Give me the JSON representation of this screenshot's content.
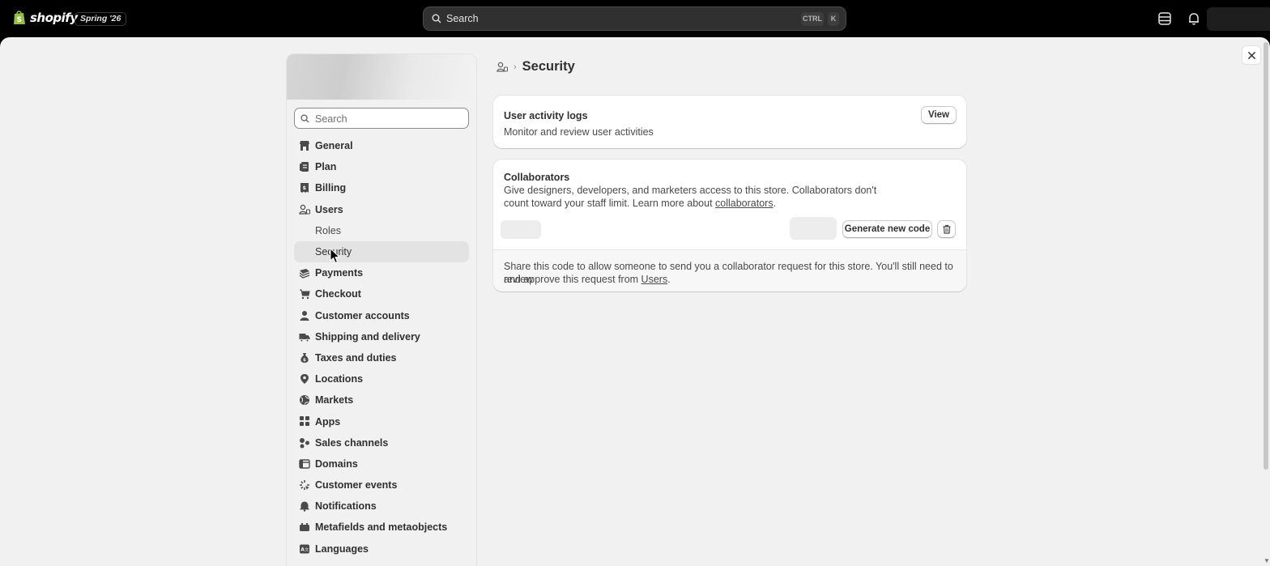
{
  "topbar": {
    "brand": "shopify",
    "edition": "Spring '26",
    "search_label": "Search",
    "shortcut_ctrl": "CTRL",
    "shortcut_key": "K",
    "icons": [
      "store-status-icon",
      "bell-icon"
    ]
  },
  "sidebar": {
    "search_placeholder": "Search",
    "items": [
      {
        "label": "General",
        "icon": "store-icon"
      },
      {
        "label": "Plan",
        "icon": "plan-icon"
      },
      {
        "label": "Billing",
        "icon": "receipt-icon"
      },
      {
        "label": "Users",
        "icon": "users-icon"
      },
      {
        "label": "Roles",
        "icon": ""
      },
      {
        "label": "Security",
        "icon": ""
      },
      {
        "label": "Payments",
        "icon": "payments-icon"
      },
      {
        "label": "Checkout",
        "icon": "cart-icon"
      },
      {
        "label": "Customer accounts",
        "icon": "person-icon"
      },
      {
        "label": "Shipping and delivery",
        "icon": "truck-icon"
      },
      {
        "label": "Taxes and duties",
        "icon": "tax-icon"
      },
      {
        "label": "Locations",
        "icon": "location-icon"
      },
      {
        "label": "Markets",
        "icon": "globe-icon"
      },
      {
        "label": "Apps",
        "icon": "apps-icon"
      },
      {
        "label": "Sales channels",
        "icon": "channels-icon"
      },
      {
        "label": "Domains",
        "icon": "domain-icon"
      },
      {
        "label": "Customer events",
        "icon": "events-icon"
      },
      {
        "label": "Notifications",
        "icon": "bell-icon"
      },
      {
        "label": "Metafields and metaobjects",
        "icon": "metafields-icon"
      },
      {
        "label": "Languages",
        "icon": "languages-icon"
      }
    ]
  },
  "main": {
    "title": "Security",
    "activity_card": {
      "title": "User activity logs",
      "description": "Monitor and review user activities",
      "view_button": "View"
    },
    "collaborators_card": {
      "title": "Collaborators",
      "description_line1": "Give designers, developers, and marketers access to this store. Collaborators don't",
      "description_line2_prefix": "count toward your staff limit. Learn more about ",
      "description_link": "collaborators",
      "description_suffix": ".",
      "generate_button": "Generate new code",
      "footer_line1": "Share this code to allow someone to send you a collaborator request for this store. You'll still need to review",
      "footer_line2_prefix": "and approve this request from ",
      "footer_link": "Users",
      "footer_suffix": "."
    }
  },
  "colors": {
    "topbar": "#000000",
    "page_bg": "#f1f1f1",
    "card_bg": "#ffffff",
    "active_nav": "#e3e3e3"
  }
}
